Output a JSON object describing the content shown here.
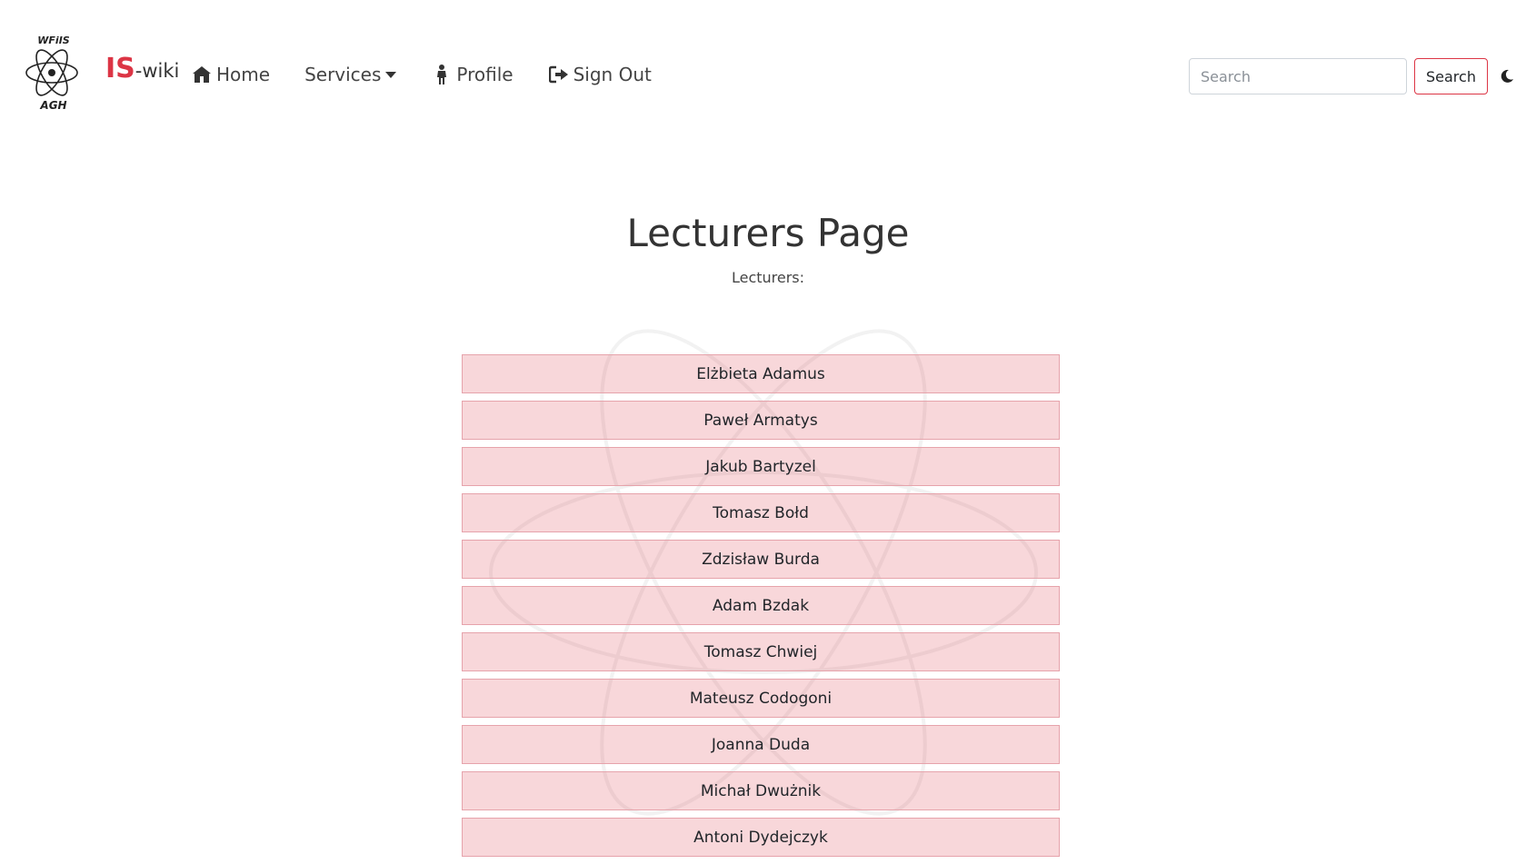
{
  "brand": {
    "logo_text_top": "WFiIS",
    "logo_text_bottom": "AGH",
    "accent": "IS",
    "suffix": "-wiki"
  },
  "nav": {
    "home": "Home",
    "services": "Services",
    "profile": "Profile",
    "signout": "Sign Out"
  },
  "search": {
    "placeholder": "Search",
    "button": "Search"
  },
  "theme_toggle_icon": "moon-icon",
  "page": {
    "title": "Lecturers Page",
    "subtitle": "Lecturers:"
  },
  "lecturers": [
    "Elżbieta Adamus",
    "Paweł Armatys",
    "Jakub Bartyzel",
    "Tomasz Bołd",
    "Zdzisław Burda",
    "Adam Bzdak",
    "Tomasz Chwiej",
    "Mateusz Codogoni",
    "Joanna Duda",
    "Michał Dwużnik",
    "Antoni Dydejczyk"
  ],
  "colors": {
    "accent": "#dc3545",
    "list_bg": "#f8d7da",
    "list_border": "#e6a3ab"
  }
}
